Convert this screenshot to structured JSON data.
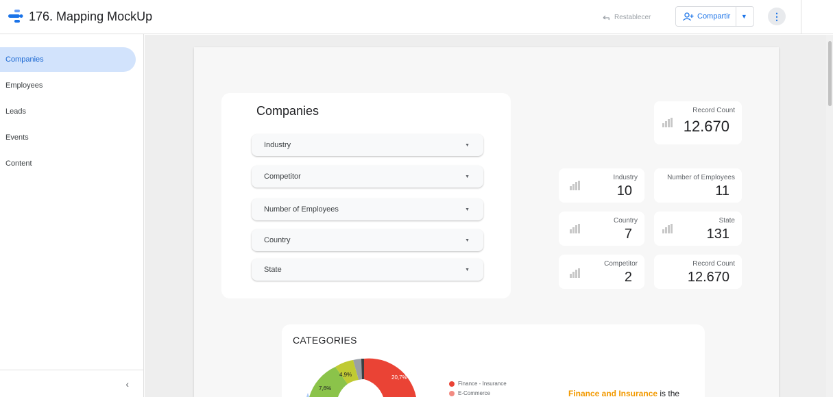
{
  "header": {
    "title": "176. Mapping MockUp",
    "reset_label": "Restablecer",
    "share_label": "Compartir"
  },
  "sidebar": {
    "items": [
      {
        "label": "Companies",
        "active": true
      },
      {
        "label": "Employees",
        "active": false
      },
      {
        "label": "Leads",
        "active": false
      },
      {
        "label": "Events",
        "active": false
      },
      {
        "label": "Content",
        "active": false
      }
    ],
    "collapse_icon": "chevron-left-icon"
  },
  "filters": {
    "title": "Companies",
    "dropdowns": [
      {
        "label": "Industry"
      },
      {
        "label": "Competitor"
      },
      {
        "label": "Number of Employees"
      },
      {
        "label": "Country"
      },
      {
        "label": "State"
      }
    ]
  },
  "kpis": {
    "record_count_top": {
      "label": "Record Count",
      "value": "12.670"
    },
    "industry": {
      "label": "Industry",
      "value": "10"
    },
    "employees": {
      "label": "Number of Employees",
      "value": "11"
    },
    "country": {
      "label": "Country",
      "value": "7"
    },
    "state": {
      "label": "State",
      "value": "131"
    },
    "competitor": {
      "label": "Competitor",
      "value": "2"
    },
    "record_count_bottom": {
      "label": "Record Count",
      "value": "12.670"
    }
  },
  "categories": {
    "title": "CATEGORIES",
    "legend": [
      {
        "label": "Finance - Insurance",
        "color": "#ea4335"
      },
      {
        "label": "E-Commerce",
        "color": "#f28b82"
      }
    ],
    "slice_labels": [
      "20,7%",
      "7,6%",
      "4,9%"
    ],
    "insight_bold": "Finance and Insurance",
    "insight_rest": " is the"
  },
  "colors": {
    "accent": "#1a73e8",
    "active_nav_bg": "#d2e3fc",
    "finance": "#ea4335",
    "green": "#8bc34a",
    "olive": "#c0ca33",
    "insight_highlight": "#f29900"
  }
}
